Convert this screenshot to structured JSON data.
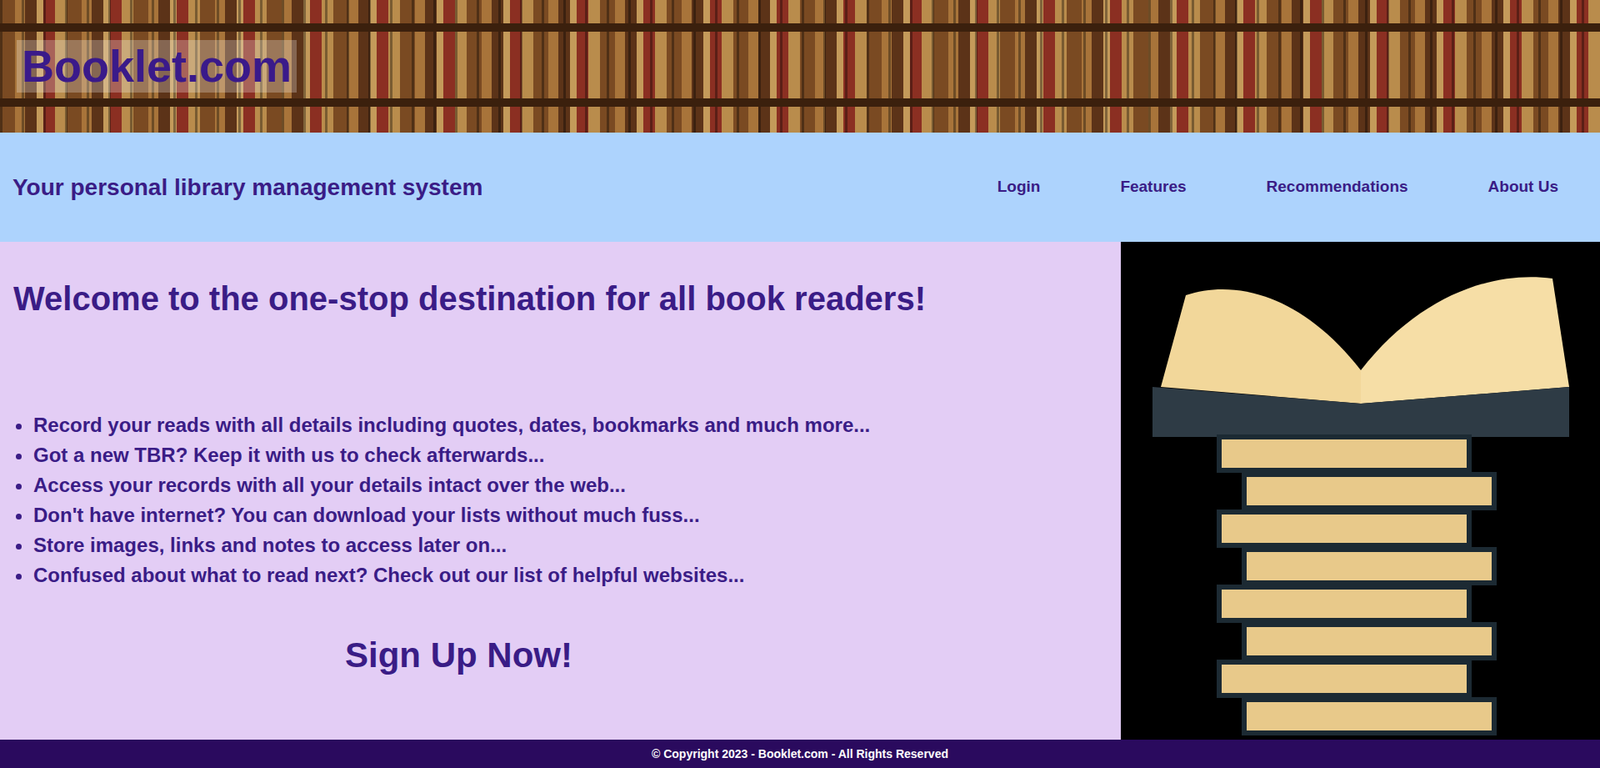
{
  "header": {
    "logo": "Booklet.com"
  },
  "navbar": {
    "tagline": "Your personal library management system",
    "links": [
      "Login",
      "Features",
      "Recommendations",
      "About Us"
    ]
  },
  "main": {
    "heading": "Welcome to the one-stop destination for all book readers!",
    "features": [
      "Record your reads with all details including quotes, dates, bookmarks and much more...",
      "Got a new TBR? Keep it with us to check afterwards...",
      "Access your records with all your details intact over the web...",
      "Don't have internet? You can download your lists without much fuss...",
      "Store images, links and notes to access later on...",
      "Confused about what to read next? Check out our list of helpful websites..."
    ],
    "cta": "Sign Up Now!"
  },
  "footer": {
    "copyright": "© Copyright 2023 - Booklet.com - All Rights Reserved"
  }
}
